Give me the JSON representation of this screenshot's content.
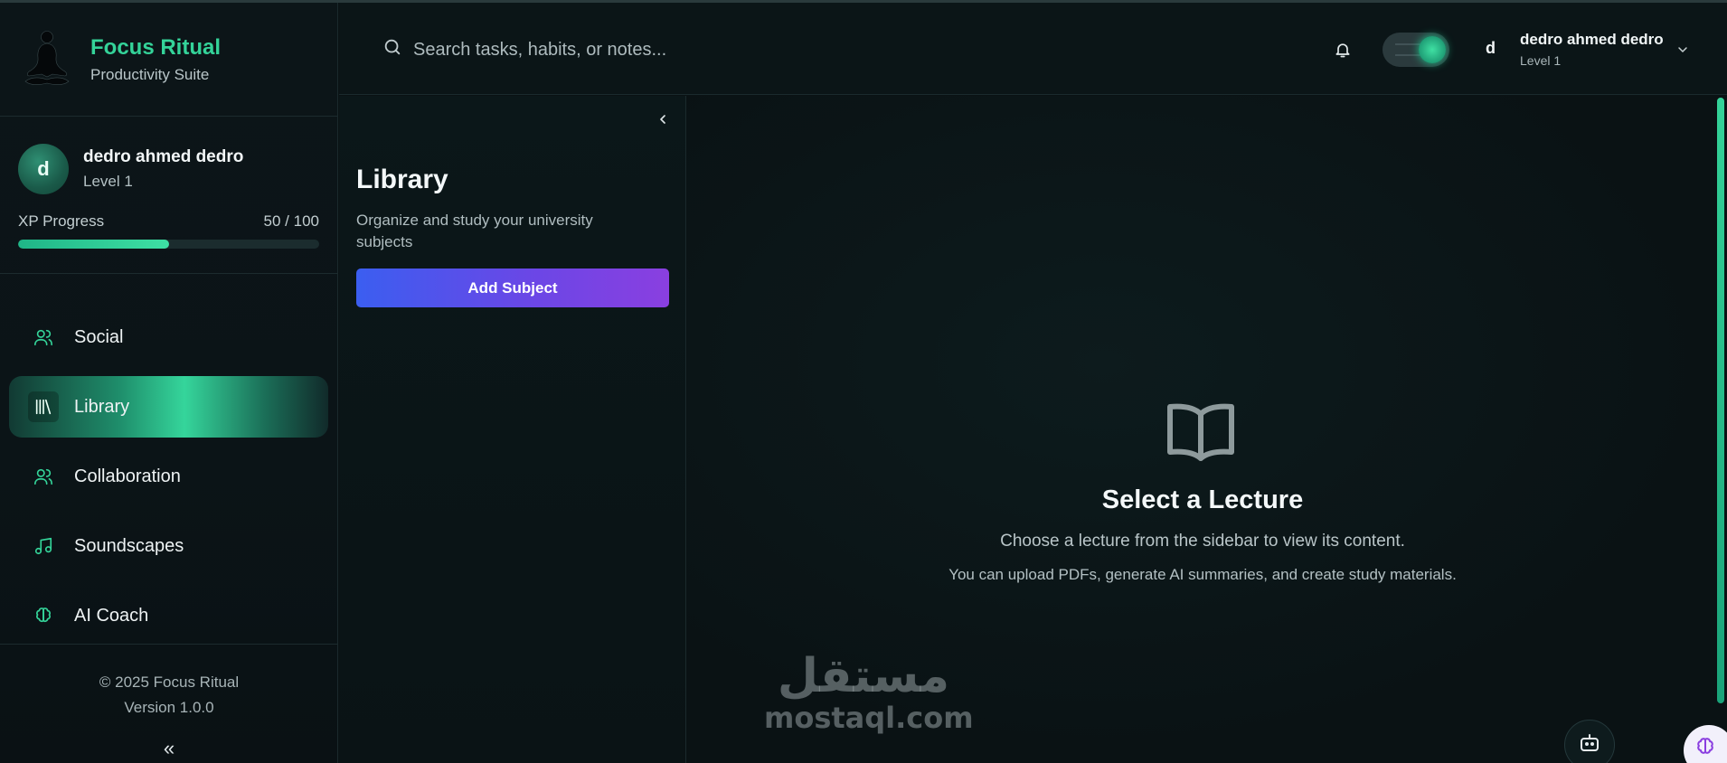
{
  "brand": {
    "title": "Focus Ritual",
    "subtitle": "Productivity Suite"
  },
  "user": {
    "initial": "d",
    "name": "dedro ahmed dedro",
    "level": "Level 1",
    "xp_label": "XP Progress",
    "xp_text": "50 / 100",
    "xp_fraction": 0.5
  },
  "nav": {
    "items": [
      {
        "label": "Social",
        "icon": "users-icon",
        "active": false
      },
      {
        "label": "Library",
        "icon": "library-icon",
        "active": true
      },
      {
        "label": "Collaboration",
        "icon": "users-icon",
        "active": false
      },
      {
        "label": "Soundscapes",
        "icon": "music-icon",
        "active": false
      },
      {
        "label": "AI Coach",
        "icon": "brain-icon",
        "active": false
      }
    ]
  },
  "footer": {
    "copyright": "© 2025 Focus Ritual",
    "version": "Version 1.0.0",
    "collapse": "«"
  },
  "header": {
    "search_placeholder": "Search tasks, habits, or notes...",
    "theme_toggle_on": true,
    "avatar_initial": "d",
    "user_name": "dedro ahmed dedro",
    "user_level": "Level 1"
  },
  "library": {
    "title": "Library",
    "description": "Organize and study your university subjects",
    "add_button": "Add Subject"
  },
  "empty_state": {
    "title": "Select a Lecture",
    "subtitle": "Choose a lecture from the sidebar to view its content.",
    "note": "You can upload PDFs, generate AI summaries, and create study materials."
  },
  "watermark": {
    "arabic": "مستقل",
    "latin": "mostaql.com"
  },
  "colors": {
    "accent": "#34d399",
    "button_start": "#3b5ef0",
    "button_end": "#8a3fe0"
  }
}
